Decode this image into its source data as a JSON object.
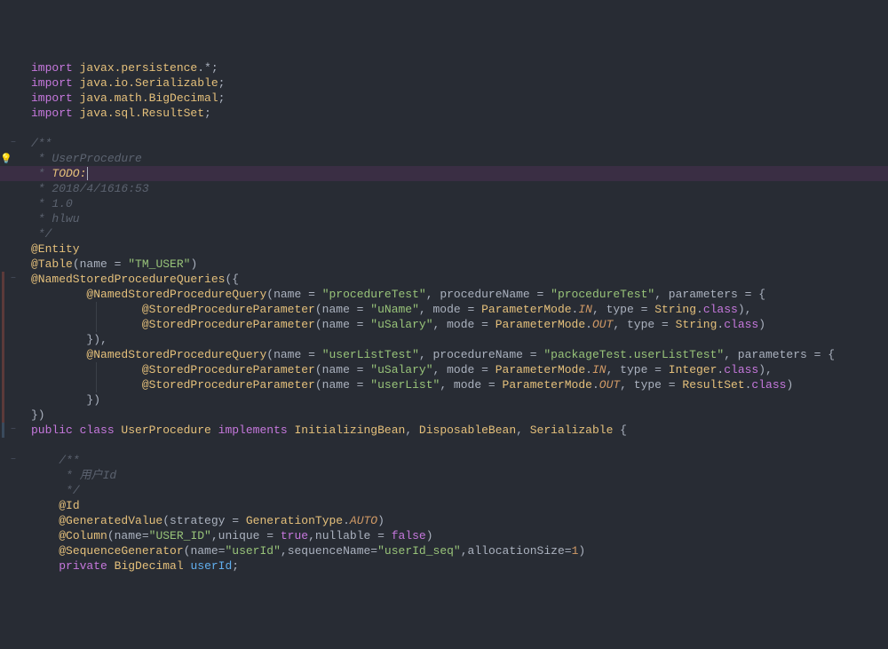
{
  "lines": [
    {
      "gutter": "",
      "fold": "",
      "content": [
        {
          "c": "kw",
          "t": "import "
        },
        {
          "c": "cls",
          "t": "javax.persistence"
        },
        {
          "c": "punct",
          "t": ".*;"
        }
      ],
      "indent": 0
    },
    {
      "gutter": "",
      "fold": "",
      "content": [
        {
          "c": "kw",
          "t": "import "
        },
        {
          "c": "cls",
          "t": "java.io.Serializable"
        },
        {
          "c": "punct",
          "t": ";"
        }
      ],
      "indent": 0
    },
    {
      "gutter": "",
      "fold": "",
      "content": [
        {
          "c": "kw",
          "t": "import "
        },
        {
          "c": "cls",
          "t": "java.math.BigDecimal"
        },
        {
          "c": "punct",
          "t": ";"
        }
      ],
      "indent": 0
    },
    {
      "gutter": "",
      "fold": "",
      "content": [
        {
          "c": "kw",
          "t": "import "
        },
        {
          "c": "cls",
          "t": "java.sql.ResultSet"
        },
        {
          "c": "punct",
          "t": ";"
        }
      ],
      "indent": 0
    },
    {
      "gutter": "",
      "fold": "",
      "content": [],
      "indent": 0
    },
    {
      "gutter": "",
      "fold": "−",
      "content": [
        {
          "c": "com",
          "t": "/**"
        }
      ],
      "indent": 0
    },
    {
      "gutter": "bulb",
      "fold": "",
      "content": [
        {
          "c": "com",
          "t": " * UserProcedure"
        }
      ],
      "indent": 0
    },
    {
      "gutter": "",
      "fold": "",
      "content": [
        {
          "c": "com",
          "t": " * "
        },
        {
          "c": "todo",
          "t": "TODO:"
        }
      ],
      "indent": 0,
      "hl": true,
      "caret": true
    },
    {
      "gutter": "",
      "fold": "",
      "content": [
        {
          "c": "com",
          "t": " * 2018/4/1616:53"
        }
      ],
      "indent": 0
    },
    {
      "gutter": "",
      "fold": "",
      "content": [
        {
          "c": "com",
          "t": " * 1.0"
        }
      ],
      "indent": 0
    },
    {
      "gutter": "",
      "fold": "",
      "content": [
        {
          "c": "com",
          "t": " * hlwu"
        }
      ],
      "indent": 0
    },
    {
      "gutter": "",
      "fold": "",
      "content": [
        {
          "c": "com",
          "t": " */"
        }
      ],
      "indent": 0
    },
    {
      "gutter": "",
      "fold": "",
      "content": [
        {
          "c": "ann",
          "t": "@Entity"
        }
      ],
      "indent": 0
    },
    {
      "gutter": "",
      "fold": "",
      "content": [
        {
          "c": "ann",
          "t": "@Table"
        },
        {
          "c": "punct",
          "t": "(name = "
        },
        {
          "c": "str",
          "t": "\"TM_USER\""
        },
        {
          "c": "punct",
          "t": ")"
        }
      ],
      "indent": 0
    },
    {
      "gutter": "red",
      "fold": "−",
      "content": [
        {
          "c": "ann",
          "t": "@NamedStoredProcedureQueries"
        },
        {
          "c": "punct",
          "t": "({"
        }
      ],
      "indent": 0
    },
    {
      "gutter": "red",
      "fold": "",
      "content": [
        {
          "c": "ann",
          "t": "@NamedStoredProcedureQuery"
        },
        {
          "c": "punct",
          "t": "(name = "
        },
        {
          "c": "str",
          "t": "\"procedureTest\""
        },
        {
          "c": "punct",
          "t": ", procedureName = "
        },
        {
          "c": "str",
          "t": "\"procedureTest\""
        },
        {
          "c": "punct",
          "t": ", parameters = {"
        }
      ],
      "indent": 8
    },
    {
      "gutter": "red",
      "fold": "",
      "content": [
        {
          "c": "ann",
          "t": "@StoredProcedureParameter"
        },
        {
          "c": "punct",
          "t": "(name = "
        },
        {
          "c": "str",
          "t": "\"uName\""
        },
        {
          "c": "punct",
          "t": ", mode = "
        },
        {
          "c": "cls",
          "t": "ParameterMode"
        },
        {
          "c": "punct",
          "t": "."
        },
        {
          "c": "const",
          "t": "IN"
        },
        {
          "c": "punct",
          "t": ", type = "
        },
        {
          "c": "cls",
          "t": "String"
        },
        {
          "c": "punct",
          "t": "."
        },
        {
          "c": "kw",
          "t": "class"
        },
        {
          "c": "punct",
          "t": "),"
        }
      ],
      "indent": 16,
      "guide": [
        88
      ]
    },
    {
      "gutter": "red",
      "fold": "",
      "content": [
        {
          "c": "ann",
          "t": "@StoredProcedureParameter"
        },
        {
          "c": "punct",
          "t": "(name = "
        },
        {
          "c": "str",
          "t": "\"uSalary\""
        },
        {
          "c": "punct",
          "t": ", mode = "
        },
        {
          "c": "cls",
          "t": "ParameterMode"
        },
        {
          "c": "punct",
          "t": "."
        },
        {
          "c": "const",
          "t": "OUT"
        },
        {
          "c": "punct",
          "t": ", type = "
        },
        {
          "c": "cls",
          "t": "String"
        },
        {
          "c": "punct",
          "t": "."
        },
        {
          "c": "kw",
          "t": "class"
        },
        {
          "c": "punct",
          "t": ")"
        }
      ],
      "indent": 16,
      "guide": [
        88
      ]
    },
    {
      "gutter": "red",
      "fold": "",
      "content": [
        {
          "c": "punct",
          "t": "}),"
        }
      ],
      "indent": 8
    },
    {
      "gutter": "red",
      "fold": "",
      "content": [
        {
          "c": "ann",
          "t": "@NamedStoredProcedureQuery"
        },
        {
          "c": "punct",
          "t": "(name = "
        },
        {
          "c": "str",
          "t": "\"userListTest\""
        },
        {
          "c": "punct",
          "t": ", procedureName = "
        },
        {
          "c": "str",
          "t": "\"packageTest.userListTest\""
        },
        {
          "c": "punct",
          "t": ", parameters = {"
        }
      ],
      "indent": 8
    },
    {
      "gutter": "red",
      "fold": "",
      "content": [
        {
          "c": "ann",
          "t": "@StoredProcedureParameter"
        },
        {
          "c": "punct",
          "t": "(name = "
        },
        {
          "c": "str",
          "t": "\"uSalary\""
        },
        {
          "c": "punct",
          "t": ", mode = "
        },
        {
          "c": "cls",
          "t": "ParameterMode"
        },
        {
          "c": "punct",
          "t": "."
        },
        {
          "c": "const",
          "t": "IN"
        },
        {
          "c": "punct",
          "t": ", type = "
        },
        {
          "c": "cls",
          "t": "Integer"
        },
        {
          "c": "punct",
          "t": "."
        },
        {
          "c": "kw",
          "t": "class"
        },
        {
          "c": "punct",
          "t": "),"
        }
      ],
      "indent": 16,
      "guide": [
        88
      ]
    },
    {
      "gutter": "red",
      "fold": "",
      "content": [
        {
          "c": "ann",
          "t": "@StoredProcedureParameter"
        },
        {
          "c": "punct",
          "t": "(name = "
        },
        {
          "c": "str",
          "t": "\"userList\""
        },
        {
          "c": "punct",
          "t": ", mode = "
        },
        {
          "c": "cls",
          "t": "ParameterMode"
        },
        {
          "c": "punct",
          "t": "."
        },
        {
          "c": "const",
          "t": "OUT"
        },
        {
          "c": "punct",
          "t": ", type = "
        },
        {
          "c": "cls",
          "t": "ResultSet"
        },
        {
          "c": "punct",
          "t": "."
        },
        {
          "c": "kw",
          "t": "class"
        },
        {
          "c": "punct",
          "t": ")"
        }
      ],
      "indent": 16,
      "guide": [
        88
      ]
    },
    {
      "gutter": "red",
      "fold": "",
      "content": [
        {
          "c": "punct",
          "t": "})"
        }
      ],
      "indent": 8
    },
    {
      "gutter": "red",
      "fold": "",
      "content": [
        {
          "c": "punct",
          "t": "})"
        }
      ],
      "indent": 0
    },
    {
      "gutter": "blue",
      "fold": "−",
      "content": [
        {
          "c": "kw",
          "t": "public class "
        },
        {
          "c": "cls",
          "t": "UserProcedure"
        },
        {
          "c": "punct",
          "t": " "
        },
        {
          "c": "kw",
          "t": "implements"
        },
        {
          "c": "punct",
          "t": " "
        },
        {
          "c": "cls",
          "t": "InitializingBean"
        },
        {
          "c": "punct",
          "t": ", "
        },
        {
          "c": "cls",
          "t": "DisposableBean"
        },
        {
          "c": "punct",
          "t": ", "
        },
        {
          "c": "cls",
          "t": "Serializable"
        },
        {
          "c": "punct",
          "t": " {"
        }
      ],
      "indent": 0
    },
    {
      "gutter": "",
      "fold": "",
      "content": [],
      "indent": 0
    },
    {
      "gutter": "",
      "fold": "−",
      "content": [
        {
          "c": "com",
          "t": "/**"
        }
      ],
      "indent": 4
    },
    {
      "gutter": "",
      "fold": "",
      "content": [
        {
          "c": "com",
          "t": " * 用户Id"
        }
      ],
      "indent": 4
    },
    {
      "gutter": "",
      "fold": "",
      "content": [
        {
          "c": "com",
          "t": " */"
        }
      ],
      "indent": 4
    },
    {
      "gutter": "",
      "fold": "",
      "content": [
        {
          "c": "ann",
          "t": "@Id"
        }
      ],
      "indent": 4
    },
    {
      "gutter": "",
      "fold": "",
      "content": [
        {
          "c": "ann",
          "t": "@GeneratedValue"
        },
        {
          "c": "punct",
          "t": "(strategy = "
        },
        {
          "c": "cls",
          "t": "GenerationType"
        },
        {
          "c": "punct",
          "t": "."
        },
        {
          "c": "const",
          "t": "AUTO"
        },
        {
          "c": "punct",
          "t": ")"
        }
      ],
      "indent": 4
    },
    {
      "gutter": "",
      "fold": "",
      "content": [
        {
          "c": "ann",
          "t": "@Column"
        },
        {
          "c": "punct",
          "t": "(name="
        },
        {
          "c": "str",
          "t": "\"USER_ID\""
        },
        {
          "c": "punct",
          "t": ",unique = "
        },
        {
          "c": "kw",
          "t": "true"
        },
        {
          "c": "punct",
          "t": ",nullable = "
        },
        {
          "c": "kw",
          "t": "false"
        },
        {
          "c": "punct",
          "t": ")"
        }
      ],
      "indent": 4
    },
    {
      "gutter": "",
      "fold": "",
      "content": [
        {
          "c": "ann",
          "t": "@SequenceGenerator"
        },
        {
          "c": "punct",
          "t": "(name="
        },
        {
          "c": "str",
          "t": "\"userId\""
        },
        {
          "c": "punct",
          "t": ",sequenceName="
        },
        {
          "c": "str",
          "t": "\"userId_seq\""
        },
        {
          "c": "punct",
          "t": ",allocationSize="
        },
        {
          "c": "num",
          "t": "1"
        },
        {
          "c": "punct",
          "t": ")"
        }
      ],
      "indent": 4
    },
    {
      "gutter": "",
      "fold": "",
      "content": [
        {
          "c": "kw",
          "t": "private "
        },
        {
          "c": "cls",
          "t": "BigDecimal"
        },
        {
          "c": "punct",
          "t": " "
        },
        {
          "c": "fn",
          "t": "userId"
        },
        {
          "c": "punct",
          "t": ";"
        }
      ],
      "indent": 4
    }
  ]
}
